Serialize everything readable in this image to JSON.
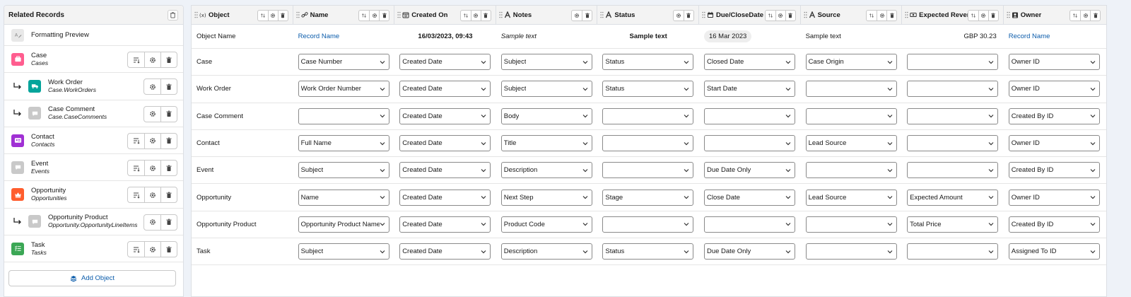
{
  "left_panel": {
    "title": "Related Records",
    "preview_label": "Formatting Preview",
    "items": [
      {
        "name": "Case",
        "sub": "Cases",
        "color": "#ff5d8f",
        "icon": "briefcase-icon",
        "child": false,
        "sort": true
      },
      {
        "name": "Work Order",
        "sub": "Case.WorkOrders",
        "color": "#04a49b",
        "icon": "truck-icon",
        "child": true,
        "sort": false
      },
      {
        "name": "Case Comment",
        "sub": "Case.CaseComments",
        "color": "#c9c9c9",
        "icon": "comment-icon",
        "child": true,
        "sort": false
      },
      {
        "name": "Contact",
        "sub": "Contacts",
        "color": "#a030d4",
        "icon": "contact-card-icon",
        "child": false,
        "sort": true
      },
      {
        "name": "Event",
        "sub": "Events",
        "color": "#c9c9c9",
        "icon": "comment-icon",
        "child": false,
        "sort": true
      },
      {
        "name": "Opportunity",
        "sub": "Opportunities",
        "color": "#ff5d2d",
        "icon": "crown-icon",
        "child": false,
        "sort": true
      },
      {
        "name": "Opportunity Product",
        "sub": "Opportunity.OpportunityLineItems",
        "color": "#c9c9c9",
        "icon": "comment-icon",
        "child": true,
        "sort": false
      },
      {
        "name": "Task",
        "sub": "Tasks",
        "color": "#3ba755",
        "icon": "task-list-icon",
        "child": false,
        "sort": true
      }
    ],
    "add_label": "Add Object"
  },
  "table": {
    "columns": [
      {
        "label": "Object",
        "icon": "formula-icon"
      },
      {
        "label": "Name",
        "icon": "link-icon"
      },
      {
        "label": "Created On",
        "icon": "calendar-clock-icon"
      },
      {
        "label": "Notes",
        "icon": "text-icon"
      },
      {
        "label": "Status",
        "icon": "text-icon"
      },
      {
        "label": "Due/CloseDate",
        "icon": "calendar-icon"
      },
      {
        "label": "Source",
        "icon": "text-icon"
      },
      {
        "label": "Expected Revenue",
        "icon": "currency-icon"
      },
      {
        "label": "Owner",
        "icon": "user-badge-icon"
      }
    ],
    "preview": [
      "Object Name",
      "Record Name",
      "16/03/2023, 09:43",
      "Sample text",
      "Sample text",
      "16 Mar 2023",
      "Sample text",
      "GBP 30.23",
      "Record Name"
    ],
    "rows": [
      {
        "object": "Case",
        "cells": [
          "Case Number",
          "Created Date",
          "Subject",
          "Status",
          "Closed Date",
          "Case Origin",
          "",
          "Owner ID"
        ]
      },
      {
        "object": "Work Order",
        "cells": [
          "Work Order Number",
          "Created Date",
          "Subject",
          "Status",
          "Start Date",
          "",
          "",
          "Owner ID"
        ]
      },
      {
        "object": "Case Comment",
        "cells": [
          "",
          "Created Date",
          "Body",
          "",
          "",
          "",
          "",
          "Created By ID"
        ]
      },
      {
        "object": "Contact",
        "cells": [
          "Full Name",
          "Created Date",
          "Title",
          "",
          "",
          "Lead Source",
          "",
          "Owner ID"
        ]
      },
      {
        "object": "Event",
        "cells": [
          "Subject",
          "Created Date",
          "Description",
          "",
          "Due Date Only",
          "",
          "",
          "Created By ID"
        ]
      },
      {
        "object": "Opportunity",
        "cells": [
          "Name",
          "Created Date",
          "Next Step",
          "Stage",
          "Close Date",
          "Lead Source",
          "Expected Amount",
          "Owner ID"
        ]
      },
      {
        "object": "Opportunity Product",
        "cells": [
          "Opportunity Product Name",
          "Created Date",
          "Product Code",
          "",
          "",
          "",
          "Total Price",
          "Created By ID"
        ]
      },
      {
        "object": "Task",
        "cells": [
          "Subject",
          "Created Date",
          "Description",
          "Status",
          "Due Date Only",
          "",
          "",
          "Assigned To ID"
        ]
      }
    ]
  }
}
